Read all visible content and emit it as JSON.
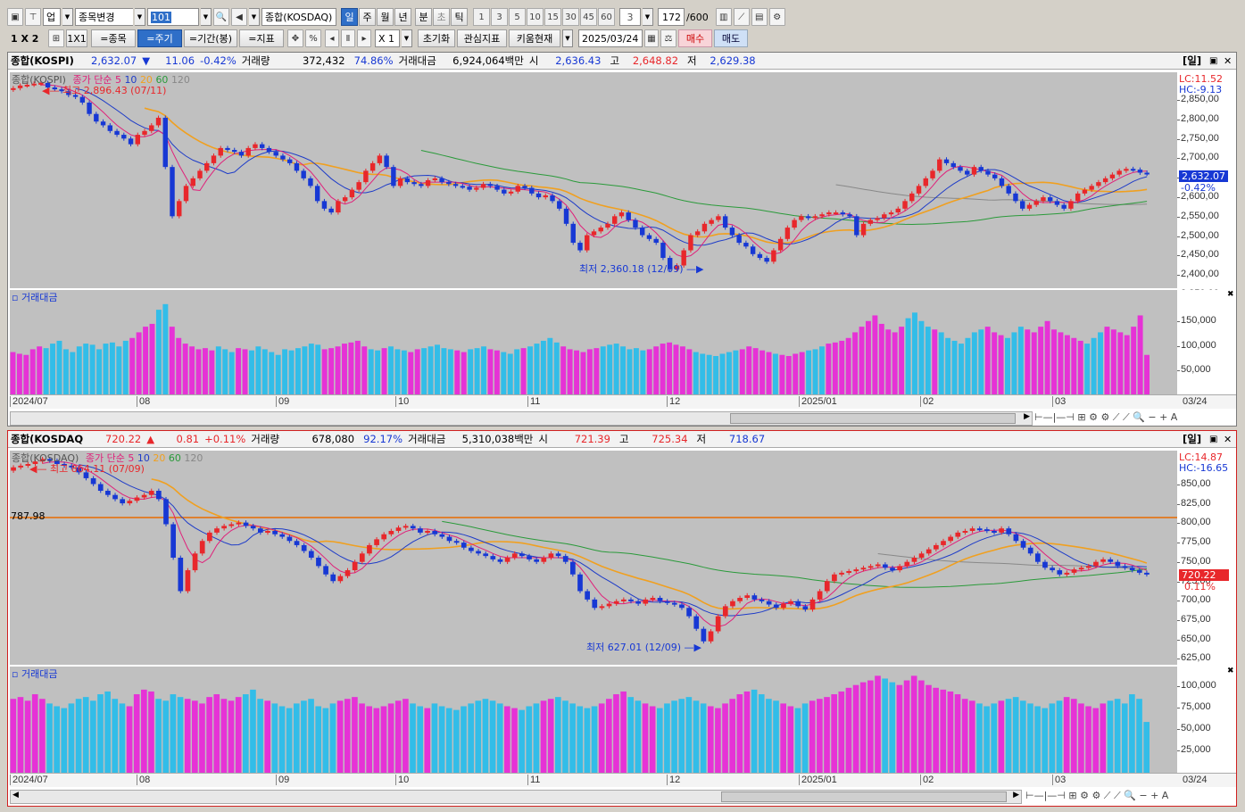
{
  "toolbar1": {
    "market": "업",
    "code_menu": "종목변경",
    "code_value": "101",
    "index_name": "종합(KOSDAQ)",
    "periods": [
      "일",
      "주",
      "월",
      "년",
      "분",
      "초",
      "틱"
    ],
    "active_period": "일",
    "minute_values": [
      "1",
      "3",
      "5",
      "10",
      "15",
      "30",
      "45",
      "60"
    ],
    "count_value": "3",
    "bar_count": "172",
    "bar_max": "/600"
  },
  "toolbar2": {
    "layout": "1 X 2",
    "grid": "1X1",
    "stock_btn": "=종목",
    "period_btn": "=주기",
    "range_btn": "=기간(봉)",
    "indicator_btn": "=지표",
    "percent_btn": "%",
    "zoom_value": "X 1",
    "init_btn": "초기화",
    "favorite_btn": "관심지표",
    "kiwoom_btn": "키움현재",
    "date_value": "2025/03/24",
    "buy_btn": "매수",
    "sell_btn": "매도"
  },
  "colors": {
    "up": "#e8272b",
    "down": "#1738d4",
    "ma5": "#e0207a",
    "ma10": "#1e3cc8",
    "ma20": "#f0a020",
    "ma60": "#2a9a3a",
    "ma120": "#888888",
    "vol_up": "#e632d6",
    "vol_down": "#32bde8",
    "plot_bg": "#c0c0c0",
    "hline": "#e86a00"
  },
  "pane1": {
    "info": {
      "name": "종합(KOSPI)",
      "price": "2,632.07",
      "arrow": "▼",
      "change": "11.06",
      "pct": "-0.42%",
      "vol_label": "거래량",
      "volume": "372,432",
      "vol_pct": "74.86%",
      "amt_label": "거래대금",
      "amount": "6,924,064백만",
      "open_label": "시",
      "open": "2,636.43",
      "high_label": "고",
      "high": "2,648.82",
      "low_label": "저",
      "low": "2,629.38",
      "period_tag": "[일]"
    },
    "legend": {
      "name": "종합(KOSPI)",
      "ma_label": "종가 단순",
      "ma": [
        "5",
        "10",
        "20",
        "60",
        "120"
      ]
    },
    "high_note": "최고 2,896.43 (07/11)",
    "low_note": "최저 2,360.18 (12/09)",
    "lc": "LC:11.52",
    "hc": "HC:-9.13",
    "cur_price": "2,632.07",
    "cur_pct": "-0.42%",
    "y_labels": [
      "2,850,00",
      "2,800,00",
      "2,750,00",
      "2,700,00",
      "2,650,00",
      "2,600,00",
      "2,550,00",
      "2,500,00",
      "2,450,00",
      "2,400,00",
      "2,350,00"
    ],
    "vol_title": "거래대금",
    "vol_labels": [
      "150,000",
      "100,000",
      "50,000"
    ],
    "x_labels": [
      "2024/07",
      "08",
      "09",
      "10",
      "11",
      "12",
      "2025/01",
      "02",
      "03"
    ],
    "x_end": "03/24"
  },
  "pane2": {
    "info": {
      "name": "종합(KOSDAQ",
      "price": "720.22",
      "arrow": "▲",
      "change": "0.81",
      "pct": "+0.11%",
      "vol_label": "거래량",
      "volume": "678,080",
      "vol_pct": "92.17%",
      "amt_label": "거래대금",
      "amount": "5,310,038백만",
      "open_label": "시",
      "open": "721.39",
      "high_label": "고",
      "high": "725.34",
      "low_label": "저",
      "low": "718.67",
      "period_tag": "[일]"
    },
    "legend": {
      "name": "종합(KOSDAQ)",
      "ma_label": "종가 단순",
      "ma": [
        "5",
        "10",
        "20",
        "60",
        "120"
      ]
    },
    "high_note": "최고 864.11 (07/09)",
    "low_note": "최저 627.01 (12/09)",
    "hline_label": "787.98",
    "lc": "LC:14.87",
    "hc": "HC:-16.65",
    "cur_price": "720.22",
    "cur_pct": "0.11%",
    "y_labels": [
      "850,00",
      "825,00",
      "800,00",
      "775,00",
      "750,00",
      "725,00",
      "700,00",
      "675,00",
      "650,00",
      "625,00"
    ],
    "vol_title": "거래대금",
    "vol_labels": [
      "100,000",
      "75,000",
      "50,000",
      "25,000"
    ],
    "x_labels": [
      "2024/07",
      "08",
      "09",
      "10",
      "11",
      "12",
      "2025/01",
      "02",
      "03"
    ],
    "x_end": "03/24"
  },
  "chart_data": [
    {
      "type": "candlestick",
      "title": "종합(KOSPI)",
      "ylim": [
        2330,
        2900
      ],
      "high": 2896.43,
      "low": 2360.18,
      "last": 2632.07,
      "closes": [
        2858,
        2865,
        2867,
        2870,
        2872,
        2860,
        2855,
        2850,
        2840,
        2835,
        2820,
        2790,
        2770,
        2760,
        2745,
        2735,
        2725,
        2710,
        2735,
        2745,
        2760,
        2780,
        2650,
        2520,
        2560,
        2600,
        2620,
        2640,
        2660,
        2680,
        2700,
        2695,
        2690,
        2680,
        2700,
        2710,
        2700,
        2690,
        2680,
        2670,
        2660,
        2640,
        2620,
        2600,
        2560,
        2540,
        2530,
        2560,
        2570,
        2590,
        2610,
        2640,
        2660,
        2680,
        2650,
        2600,
        2620,
        2610,
        2605,
        2600,
        2615,
        2620,
        2610,
        2605,
        2600,
        2598,
        2590,
        2595,
        2605,
        2600,
        2590,
        2580,
        2585,
        2600,
        2595,
        2580,
        2570,
        2575,
        2560,
        2540,
        2500,
        2450,
        2430,
        2470,
        2480,
        2490,
        2500,
        2520,
        2530,
        2510,
        2490,
        2470,
        2460,
        2450,
        2410,
        2380,
        2390,
        2430,
        2470,
        2480,
        2500,
        2510,
        2520,
        2490,
        2470,
        2450,
        2440,
        2420,
        2410,
        2400,
        2430,
        2460,
        2490,
        2510,
        2520,
        2515,
        2520,
        2525,
        2530,
        2530,
        2525,
        2520,
        2470,
        2500,
        2510,
        2515,
        2525,
        2530,
        2540,
        2560,
        2580,
        2600,
        2620,
        2640,
        2670,
        2660,
        2650,
        2640,
        2630,
        2650,
        2640,
        2630,
        2620,
        2600,
        2580,
        2560,
        2540,
        2550,
        2560,
        2570,
        2560,
        2550,
        2540,
        2560,
        2580,
        2590,
        2600,
        2610,
        2620,
        2630,
        2640,
        2645,
        2643,
        2635,
        2632
      ],
      "volumes": [
        75,
        72,
        70,
        80,
        85,
        82,
        90,
        95,
        80,
        75,
        85,
        90,
        88,
        80,
        90,
        92,
        85,
        95,
        100,
        110,
        120,
        125,
        150,
        160,
        120,
        100,
        90,
        85,
        80,
        82,
        78,
        85,
        80,
        75,
        82,
        80,
        78,
        85,
        80,
        75,
        70,
        80,
        78,
        82,
        85,
        90,
        88,
        80,
        82,
        85,
        90,
        92,
        95,
        85,
        80,
        78,
        82,
        85,
        80,
        78,
        75,
        80,
        82,
        85,
        88,
        82,
        80,
        78,
        75,
        80,
        82,
        85,
        80,
        78,
        75,
        72,
        80,
        82,
        85,
        90,
        95,
        100,
        92,
        85,
        80,
        78,
        75,
        80,
        82,
        85,
        88,
        90,
        85,
        80,
        82,
        78,
        80,
        85,
        90,
        92,
        88,
        85,
        80,
        75,
        72,
        70,
        68,
        72,
        75,
        78,
        80,
        85,
        82,
        78,
        75,
        72,
        70,
        68,
        72,
        75,
        78,
        80,
        85,
        90,
        92,
        95,
        100,
        110,
        120,
        130,
        140,
        125,
        115,
        110,
        120,
        135,
        145,
        130,
        120,
        115,
        110,
        100,
        95,
        90,
        100,
        110,
        115,
        120,
        110,
        105,
        100,
        110,
        120,
        115,
        110,
        120,
        130,
        115,
        110,
        105,
        100,
        95,
        90,
        100,
        110,
        120,
        115,
        110,
        105,
        120,
        140,
        70
      ]
    },
    {
      "type": "candlestick",
      "title": "종합(KOSDAQ)",
      "ylim": [
        612,
        868
      ],
      "high": 864.11,
      "low": 627.01,
      "last": 720.22,
      "ref_line": 787.98,
      "closes": [
        848,
        850,
        852,
        855,
        858,
        856,
        852,
        850,
        848,
        842,
        835,
        828,
        820,
        815,
        810,
        805,
        808,
        812,
        815,
        820,
        810,
        780,
        740,
        700,
        725,
        745,
        760,
        770,
        775,
        778,
        780,
        782,
        778,
        775,
        770,
        772,
        768,
        765,
        760,
        755,
        748,
        740,
        730,
        720,
        712,
        718,
        725,
        735,
        745,
        755,
        762,
        768,
        772,
        776,
        778,
        775,
        770,
        772,
        768,
        765,
        760,
        758,
        752,
        748,
        745,
        742,
        738,
        735,
        740,
        745,
        742,
        738,
        735,
        740,
        745,
        742,
        735,
        720,
        700,
        690,
        680,
        682,
        685,
        688,
        690,
        688,
        685,
        690,
        692,
        688,
        686,
        684,
        680,
        670,
        655,
        640,
        652,
        670,
        682,
        688,
        692,
        695,
        690,
        688,
        684,
        680,
        685,
        688,
        682,
        678,
        690,
        700,
        712,
        720,
        722,
        724,
        726,
        728,
        730,
        732,
        728,
        725,
        730,
        735,
        740,
        745,
        750,
        755,
        760,
        765,
        770,
        772,
        775,
        774,
        772,
        770,
        775,
        768,
        760,
        752,
        745,
        735,
        728,
        725,
        720,
        722,
        726,
        728,
        730,
        735,
        738,
        735,
        730,
        728,
        725,
        722,
        720
      ],
      "volumes": [
        80,
        82,
        78,
        85,
        80,
        75,
        72,
        70,
        75,
        80,
        82,
        78,
        85,
        88,
        80,
        75,
        72,
        85,
        90,
        88,
        80,
        78,
        85,
        82,
        80,
        78,
        75,
        82,
        85,
        80,
        78,
        82,
        85,
        90,
        80,
        78,
        75,
        72,
        70,
        75,
        78,
        80,
        72,
        70,
        75,
        78,
        80,
        82,
        75,
        72,
        70,
        72,
        75,
        78,
        80,
        75,
        72,
        70,
        75,
        72,
        70,
        68,
        72,
        75,
        78,
        80,
        78,
        75,
        72,
        70,
        68,
        72,
        75,
        78,
        80,
        82,
        78,
        75,
        72,
        70,
        72,
        75,
        80,
        85,
        88,
        82,
        78,
        75,
        72,
        70,
        75,
        78,
        80,
        82,
        78,
        75,
        72,
        70,
        75,
        80,
        85,
        88,
        90,
        85,
        80,
        78,
        75,
        72,
        70,
        75,
        78,
        80,
        82,
        85,
        88,
        92,
        95,
        98,
        100,
        105,
        102,
        98,
        95,
        100,
        105,
        100,
        95,
        92,
        90,
        88,
        85,
        80,
        78,
        75,
        72,
        75,
        78,
        80,
        82,
        78,
        75,
        72,
        70,
        75,
        78,
        82,
        80,
        75,
        72,
        70,
        75,
        78,
        80,
        75,
        85,
        80,
        55
      ]
    }
  ]
}
